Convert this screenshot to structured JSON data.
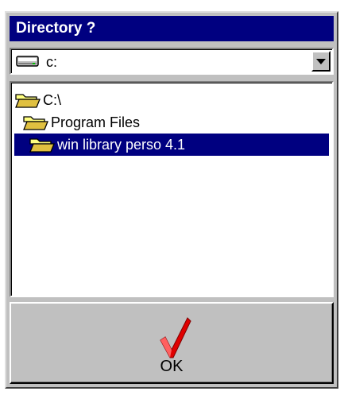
{
  "window": {
    "title": "Directory ?"
  },
  "drive_combo": {
    "value": "c:",
    "icon": "drive-icon"
  },
  "folder_list": {
    "items": [
      {
        "label": "C:\\",
        "icon": "open-folder-icon",
        "selected": false
      },
      {
        "label": "Program Files",
        "icon": "open-folder-icon",
        "selected": false
      },
      {
        "label": "win library perso 4.1",
        "icon": "open-folder-icon",
        "selected": true
      }
    ]
  },
  "ok_button": {
    "label": "OK",
    "icon": "checkmark-icon"
  },
  "colors": {
    "title_bar": "#000080",
    "selection": "#000080",
    "face": "#c0c0c0",
    "check": "#e00000"
  }
}
